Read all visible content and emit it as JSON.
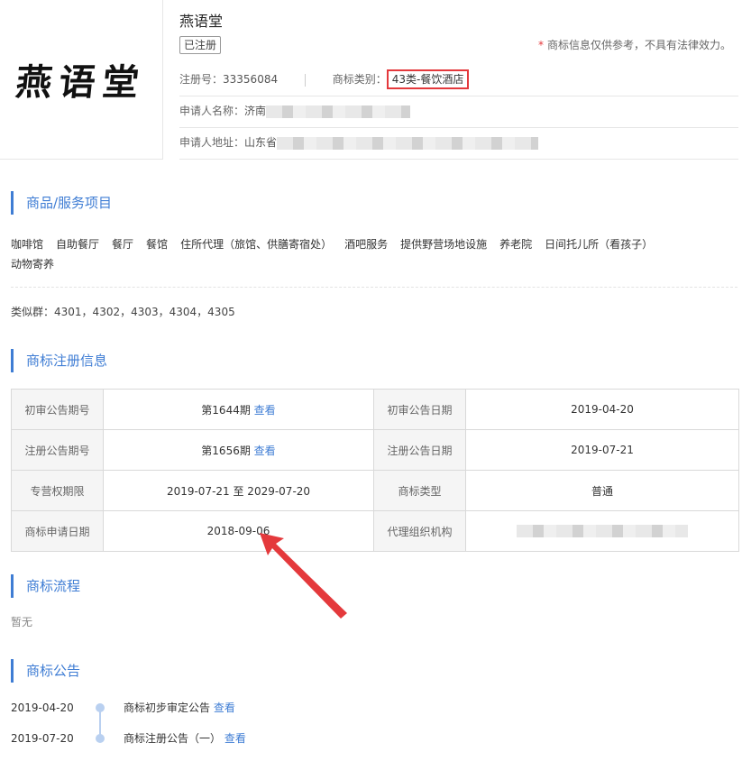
{
  "brand": {
    "logo_text": "燕语堂",
    "title": "燕语堂",
    "status_badge": "已注册",
    "disclaimer": "商标信息仅供参考，不具有法律效力。",
    "disclaimer_mark": "*"
  },
  "info": {
    "reg_no_label": "注册号：",
    "reg_no": "33356084",
    "category_label": "商标类别：",
    "category": "43类-餐饮酒店",
    "applicant_label": "申请人名称：",
    "applicant": "济南",
    "address_label": "申请人地址：",
    "address": "山东省"
  },
  "sections": {
    "goods": "商品/服务项目",
    "registration": "商标注册信息",
    "process": "商标流程",
    "announcement": "商标公告"
  },
  "goods_items": [
    "咖啡馆",
    "自助餐厅",
    "餐厅",
    "餐馆",
    "住所代理（旅馆、供膳寄宿处）",
    "酒吧服务",
    "提供野营场地设施",
    "养老院",
    "日间托儿所（看孩子）",
    "动物寄养"
  ],
  "similar": {
    "label": "类似群：",
    "value": "4301，4302，4303，4304，4305"
  },
  "reg_table": {
    "r1": {
      "k1": "初审公告期号",
      "v1": "第1644期",
      "k2": "初审公告日期",
      "v2": "2019-04-20"
    },
    "r2": {
      "k1": "注册公告期号",
      "v1": "第1656期",
      "k2": "注册公告日期",
      "v2": "2019-07-21"
    },
    "r3": {
      "k1": "专营权期限",
      "v1": "2019-07-21 至 2029-07-20",
      "k2": "商标类型",
      "v2": "普通"
    },
    "r4": {
      "k1": "商标申请日期",
      "v1": "2018-09-06",
      "k2": "代理组织机构"
    },
    "view_link": "查看"
  },
  "process_empty": "暂无",
  "timeline": [
    {
      "date": "2019-04-20",
      "text": "商标初步审定公告",
      "link": "查看"
    },
    {
      "date": "2019-07-20",
      "text": "商标注册公告（一）",
      "link": "查看"
    }
  ],
  "colors": {
    "accent": "#3f7dd4",
    "highlight": "#e4393c"
  }
}
